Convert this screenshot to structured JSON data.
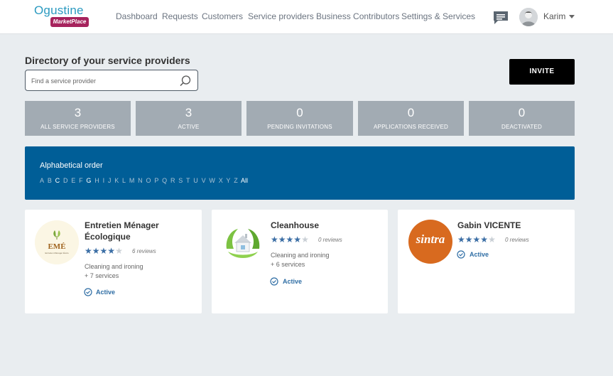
{
  "header": {
    "logo_word": "Ogustine",
    "logo_badge": "MarketPlace",
    "nav": [
      "Dashboard",
      "Requests",
      "Customers",
      "Service providers",
      "Business Contributors",
      "Settings & Services"
    ],
    "user_name": "Karim"
  },
  "directory": {
    "title": "Directory of your service providers",
    "search_placeholder": "Find a service provider",
    "invite_label": "INVITE"
  },
  "stats": [
    {
      "value": "3",
      "label": "ALL SERVICE PROVIDERS"
    },
    {
      "value": "3",
      "label": "ACTIVE"
    },
    {
      "value": "0",
      "label": "PENDING INVITATIONS"
    },
    {
      "value": "0",
      "label": "APPLICATIONS RECEIVED"
    },
    {
      "value": "0",
      "label": "DEACTIVATED"
    }
  ],
  "alphabet": {
    "title": "Alphabetical order",
    "letters": [
      "A",
      "B",
      "C",
      "D",
      "E",
      "F",
      "G",
      "H",
      "I",
      "J",
      "K",
      "L",
      "M",
      "N",
      "O",
      "P",
      "Q",
      "R",
      "S",
      "T",
      "U",
      "V",
      "W",
      "X",
      "Y",
      "Z"
    ],
    "all_label": "All"
  },
  "providers": [
    {
      "name_line1": "Entretien Ménager",
      "name_line2": "Écologique",
      "logo_text": "EMÉ",
      "logo_subtext": "Entretien Ménager Écolo",
      "stars": 4,
      "reviews": "6 reviews",
      "category": "Cleaning and ironing",
      "services": "+ 7 services",
      "status": "Active"
    },
    {
      "name_line1": "Cleanhouse",
      "name_line2": "",
      "stars": 4,
      "reviews": "0 reviews",
      "category": "Cleaning and ironing",
      "services": "+ 6 services",
      "status": "Active"
    },
    {
      "name_line1": "Gabin VICENTE",
      "name_line2": "",
      "logo_text": "sintra",
      "stars": 4,
      "reviews": "0 reviews",
      "status": "Active"
    }
  ],
  "colors": {
    "primary_blue": "#005e97",
    "stat_gray": "#a2abb3",
    "brand_magenta": "#a6235d",
    "brand_teal": "#2b9ac0",
    "star_blue": "#3b6ea5"
  }
}
